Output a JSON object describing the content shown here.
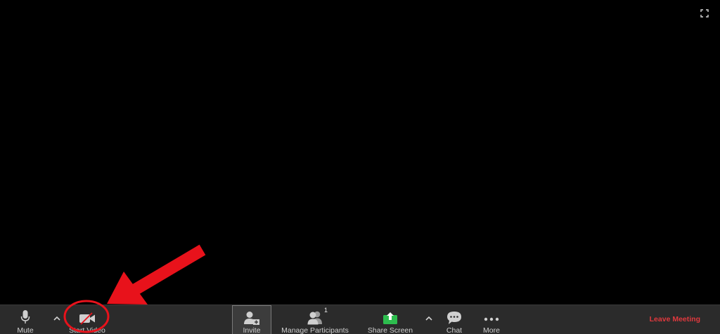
{
  "toolbar": {
    "mute_label": "Mute",
    "start_video_label": "Start Video",
    "invite_label": "Invite",
    "manage_participants_label": "Manage Participants",
    "participant_count": "1",
    "share_screen_label": "Share Screen",
    "chat_label": "Chat",
    "more_label": "More",
    "leave_meeting_label": "Leave Meeting"
  },
  "icons": {
    "fullscreen": "fullscreen-icon",
    "mute": "microphone-icon",
    "audio_options": "chevron-up-icon",
    "video": "video-camera-off-icon",
    "invite": "add-user-icon",
    "participants": "participants-icon",
    "share": "share-screen-icon",
    "share_options": "chevron-up-icon",
    "chat": "chat-bubble-icon",
    "more": "more-dots-icon"
  },
  "colors": {
    "background": "#000000",
    "toolbar": "#2b2b2b",
    "share_green": "#2dbd4e",
    "leave_red": "#e0393e",
    "annotation_red": "#e8121b"
  }
}
